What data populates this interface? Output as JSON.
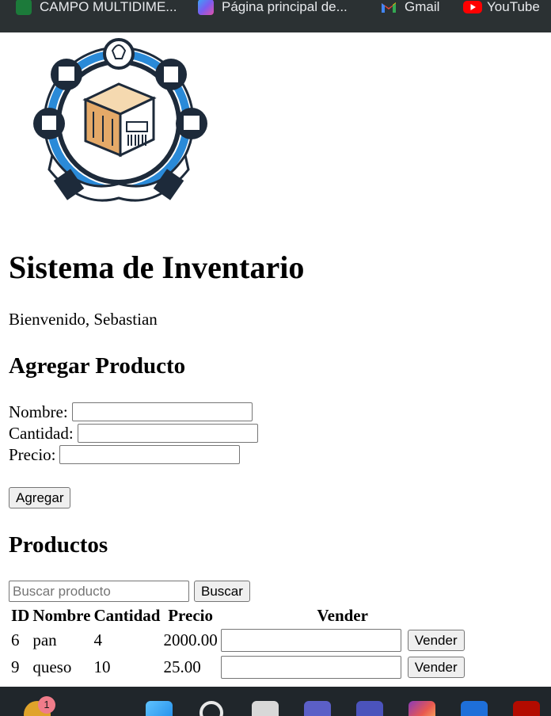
{
  "bookmarks": [
    {
      "label": "CAMPO MULTIDIME...",
      "icon": "campo-icon"
    },
    {
      "label": "Página principal de...",
      "icon": "bing-icon"
    },
    {
      "label": "Gmail",
      "icon": "gmail-icon"
    },
    {
      "label": "YouTube",
      "icon": "youtube-icon"
    }
  ],
  "page": {
    "title": "Sistema de Inventario",
    "welcome": "Bienvenido, Sebastian"
  },
  "add_form": {
    "heading": "Agregar Producto",
    "nombre_label": "Nombre:",
    "nombre_value": "",
    "cantidad_label": "Cantidad:",
    "cantidad_value": "",
    "precio_label": "Precio:",
    "precio_value": "",
    "submit_label": "Agregar"
  },
  "products": {
    "heading": "Productos",
    "search_placeholder": "Buscar producto",
    "search_button": "Buscar",
    "columns": [
      "ID",
      "Nombre",
      "Cantidad",
      "Precio",
      "Vender"
    ],
    "rows": [
      {
        "id": "6",
        "nombre": "pan",
        "cantidad": "4",
        "precio": "2000.00",
        "vender_value": "",
        "vender_button": "Vender"
      },
      {
        "id": "9",
        "nombre": "queso",
        "cantidad": "10",
        "precio": "25.00",
        "vender_value": "",
        "vender_button": "Vender"
      }
    ]
  },
  "taskbar": {
    "notification_count": "1",
    "icons": [
      "coins-icon",
      "windows-start-icon",
      "search-icon",
      "task-view-icon",
      "teams-icon",
      "teams-work-icon",
      "instagram-icon",
      "app-icon",
      "pdf-icon"
    ]
  },
  "colors": {
    "bookmarks_bar": "#2b3133",
    "taskbar": "#20262b",
    "badge": "#f07c8a"
  }
}
